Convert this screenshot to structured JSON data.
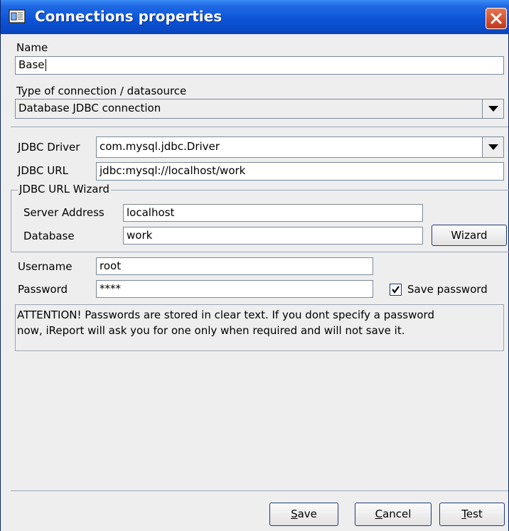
{
  "window": {
    "title": "Connections properties"
  },
  "name_section": {
    "label": "Name",
    "value": "Base"
  },
  "type_section": {
    "label": "Type of connection / datasource",
    "selected": "Database JDBC connection"
  },
  "jdbc": {
    "driver_label": "JDBC Driver",
    "driver_value": "com.mysql.jdbc.Driver",
    "url_label": "JDBC URL",
    "url_value": "jdbc:mysql://localhost/work"
  },
  "wizard_group": {
    "title": "JDBC URL Wizard",
    "server_label": "Server Address",
    "server_value": "localhost",
    "database_label": "Database",
    "database_value": "work",
    "wizard_button": "Wizard"
  },
  "credentials": {
    "username_label": "Username",
    "username_value": "root",
    "password_label": "Password",
    "password_value": "****",
    "save_password_label": "Save password",
    "save_password_checked": true
  },
  "notice": {
    "line1": "ATTENTION! Passwords are stored in clear text. If you dont specify a password",
    "line2": "now, iReport will ask you for one only when required and will not save it."
  },
  "footer": {
    "save": {
      "mnemonic": "S",
      "rest": "ave"
    },
    "cancel": {
      "mnemonic": "C",
      "rest": "ancel"
    },
    "test": {
      "mnemonic": "T",
      "rest": "est"
    }
  },
  "colors": {
    "titlebar": "#0a53d6",
    "close_button": "#d9532f",
    "panel": "#eeeeee"
  }
}
